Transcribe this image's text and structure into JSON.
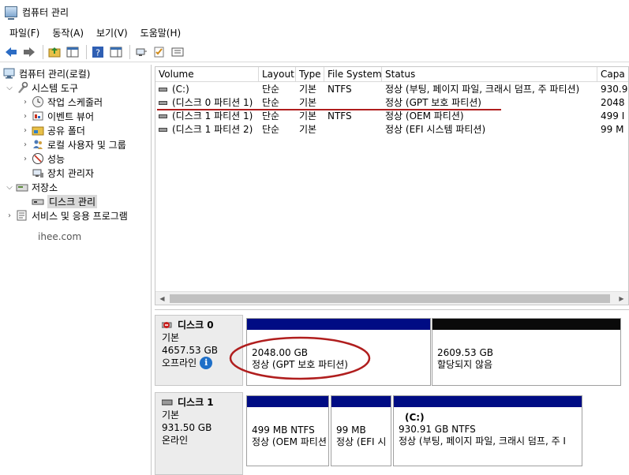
{
  "window": {
    "title": "컴퓨터 관리"
  },
  "menu": [
    "파일(F)",
    "동작(A)",
    "보기(V)",
    "도움말(H)"
  ],
  "colors": {
    "accent_bar": "#000c84",
    "unalloc_bar": "#0a0a0a",
    "annotation_red": "#b01e1e"
  },
  "tree": {
    "root": "컴퓨터 관리(로컬)",
    "system_tools": "시스템 도구",
    "task_scheduler": "작업 스케줄러",
    "event_viewer": "이벤트 뷰어",
    "shared_folders": "공유 폴더",
    "local_users": "로컬 사용자 및 그룹",
    "performance": "성능",
    "device_manager": "장치 관리자",
    "storage": "저장소",
    "disk_management": "디스크 관리",
    "services": "서비스 및 응용 프로그램"
  },
  "watermark": "ihee.com",
  "columns": {
    "volume": "Volume",
    "layout": "Layout",
    "type": "Type",
    "fs": "File System",
    "status": "Status",
    "capacity": "Capa"
  },
  "rows": [
    {
      "volume": "(C:)",
      "layout": "단순",
      "type": "기본",
      "fs": "NTFS",
      "status": "정상 (부팅, 페이지 파일, 크래시 덤프, 주 파티션)",
      "capacity": "930.9"
    },
    {
      "volume": "(디스크 0 파티션 1)",
      "layout": "단순",
      "type": "기본",
      "fs": "",
      "status": "정상 (GPT 보호 파티션)",
      "capacity": "2048"
    },
    {
      "volume": "(디스크 1 파티션 1)",
      "layout": "단순",
      "type": "기본",
      "fs": "NTFS",
      "status": "정상 (OEM 파티션)",
      "capacity": "499 I"
    },
    {
      "volume": "(디스크 1 파티션 2)",
      "layout": "단순",
      "type": "기본",
      "fs": "",
      "status": "정상 (EFI 시스템 파티션)",
      "capacity": "99 M"
    }
  ],
  "disk0": {
    "name": "디스크 0",
    "type": "기본",
    "size": "4657.53 GB",
    "state": "오프라인",
    "part1": {
      "size": "2048.00 GB",
      "status": "정상 (GPT 보호 파티션)"
    },
    "part2": {
      "size": "2609.53 GB",
      "status": "할당되지 않음"
    }
  },
  "disk1": {
    "name": "디스크 1",
    "type": "기본",
    "size": "931.50 GB",
    "state": "온라인",
    "part1": {
      "size": "499 MB NTFS",
      "status": "정상 (OEM 파티션"
    },
    "part2": {
      "size": "99 MB",
      "status": "정상 (EFI 시"
    },
    "part3": {
      "label": "(C:)",
      "size": "930.91 GB NTFS",
      "status": "정상 (부팅, 페이지 파일, 크래시 덤프, 주 I"
    }
  }
}
